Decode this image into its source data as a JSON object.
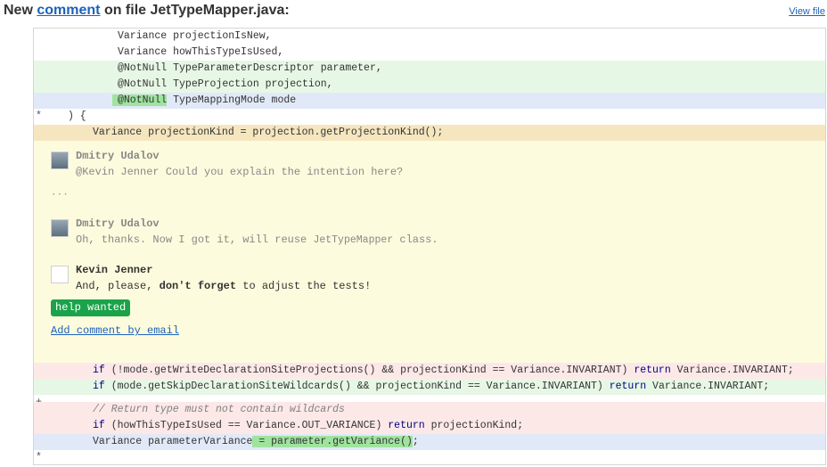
{
  "header": {
    "title_prefix": "New",
    "title_link": "comment",
    "title_suffix": "on file JetTypeMapper.java:",
    "view_file": "View file"
  },
  "code_top": [
    {
      "marker": "",
      "type": "ctx",
      "text": "Variance projectionIsNew,"
    },
    {
      "marker": "",
      "type": "ctx",
      "text": "Variance howThisTypeIsUsed,"
    },
    {
      "marker": "+",
      "type": "add",
      "text": "@NotNull TypeParameterDescriptor parameter,"
    },
    {
      "marker": "+",
      "type": "add",
      "text": "@NotNull TypeProjection projection,"
    },
    {
      "marker": "*",
      "type": "mod",
      "highlight": "@NotNull",
      "text": " TypeMappingMode mode"
    },
    {
      "marker": "",
      "type": "ctx",
      "text": ") {"
    },
    {
      "marker": "+",
      "type": "hl",
      "text": "Variance projectionKind = projection.getProjectionKind();"
    }
  ],
  "comments": [
    {
      "author": "Dmitry Udalov",
      "body": "@Kevin Jenner Could you explain the intention here?"
    },
    {
      "ellipsis": "···"
    },
    {
      "author": "Dmitry Udalov",
      "body_before": "Oh, thanks. Now I got it, will reuse ",
      "body_code": "JetTypeMapper",
      "body_after": " class."
    },
    {
      "author": "Kevin Jenner",
      "body_before": "And, please, ",
      "body_bold": "don't forget",
      "body_after": " to adjust the tests!"
    }
  ],
  "badge": "help wanted",
  "add_comment_link": "Add comment by email",
  "code_bottom": [
    {
      "marker": "–",
      "type": "del",
      "pre": "if",
      "text": " (!mode.getWriteDeclarationSiteProjections() && projectionKind == Variance.INVARIANT) ",
      "kw2": "return",
      "post": " Variance.INVARIANT;"
    },
    {
      "marker": "+",
      "type": "add",
      "pre": "if",
      "text": " (mode.getSkipDeclarationSiteWildcards() && projectionKind == Variance.INVARIANT) ",
      "kw2": "return",
      "post": " Variance.INVARIANT;"
    }
  ],
  "code_bottom2": [
    {
      "marker": "–",
      "type": "del",
      "comment": "// Return type must not contain wildcards"
    },
    {
      "marker": "–",
      "type": "del",
      "pre": "if",
      "text": " (howThisTypeIsUsed == Variance.OUT_VARIANCE) ",
      "kw2": "return",
      "post": " projectionKind;"
    },
    {
      "marker": "*",
      "type": "mod",
      "text": "Variance parameterVariance",
      "highlight": " = parameter.getVariance()",
      "post": ";"
    }
  ],
  "colors": {
    "link": "#1c62b9",
    "badge": "#1aa34a",
    "comment_bg": "#fdfbdd"
  }
}
